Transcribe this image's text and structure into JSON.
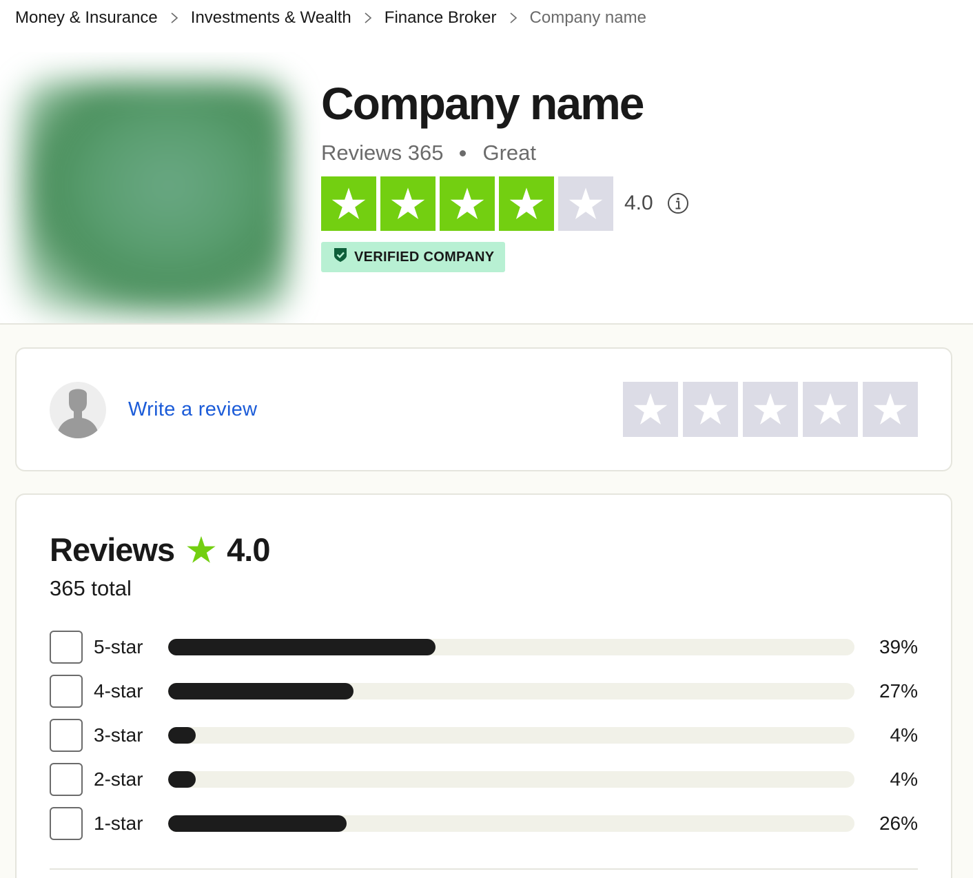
{
  "breadcrumb": [
    {
      "label": "Money & Insurance"
    },
    {
      "label": "Investments & Wealth"
    },
    {
      "label": "Finance Broker"
    },
    {
      "label": "Company name"
    }
  ],
  "company": {
    "name": "Company name",
    "reviews_label": "Reviews 365",
    "rating_word": "Great",
    "rating": "4.0",
    "verified_label": "VERIFIED COMPANY",
    "stars_filled": 4,
    "stars_total": 5
  },
  "write_review": {
    "link_label": "Write a review",
    "empty_stars": 5
  },
  "reviews_summary": {
    "title": "Reviews",
    "rating": "4.0",
    "total_label": "365 total",
    "distribution": [
      {
        "label": "5-star",
        "percent": 39,
        "percent_label": "39%"
      },
      {
        "label": "4-star",
        "percent": 27,
        "percent_label": "27%"
      },
      {
        "label": "3-star",
        "percent": 4,
        "percent_label": "4%"
      },
      {
        "label": "2-star",
        "percent": 4,
        "percent_label": "4%"
      },
      {
        "label": "1-star",
        "percent": 26,
        "percent_label": "26%"
      }
    ]
  },
  "colors": {
    "star_green": "#73cf11",
    "star_empty": "#dcdce6",
    "verified_bg": "#b8f0d3",
    "link_blue": "#1c5cd8",
    "bar_fill": "#1c1c1c",
    "bar_track": "#f1f1e8"
  },
  "icons": {
    "breadcrumb_separator": "chevron-right-icon",
    "info": "info-circle-icon",
    "verified": "shield-check-icon",
    "avatar": "user-silhouette-icon",
    "star": "star-icon"
  }
}
